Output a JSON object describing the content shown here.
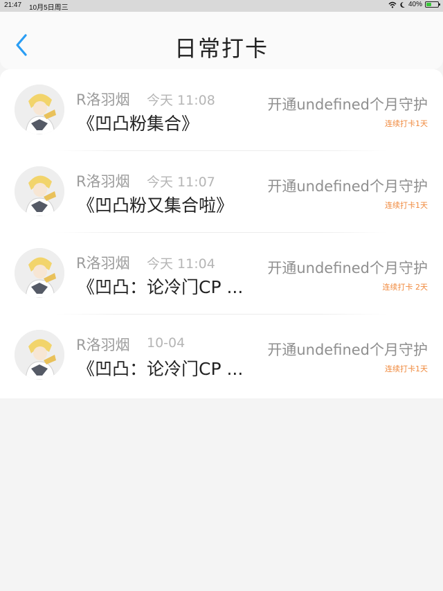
{
  "status_bar": {
    "time": "21:47",
    "date": "10月5日周三",
    "battery": "40%",
    "battery_level": 0.4,
    "wifi_icon": "wifi-icon",
    "moon_icon": "moon-icon"
  },
  "header": {
    "title": "日常打卡",
    "back_icon": "chevron-left-icon",
    "accent_color": "#2a9df4"
  },
  "colors": {
    "streak": "#f08a3e",
    "background": "#f4f4f4"
  },
  "items": [
    {
      "username": "R洛羽烟",
      "time": "今天 11:08",
      "title": "《凹凸粉集合》",
      "guard": "开通undefined个月守护",
      "streak": "连续打卡1天"
    },
    {
      "username": "R洛羽烟",
      "time": "今天 11:07",
      "title": "《凹凸粉又集合啦》",
      "guard": "开通undefined个月守护",
      "streak": "连续打卡1天"
    },
    {
      "username": "R洛羽烟",
      "time": "今天 11:04",
      "title": "《凹凸：论冷门CP ...",
      "guard": "开通undefined个月守护",
      "streak": "连续打卡 2天"
    },
    {
      "username": "R洛羽烟",
      "time": "10-04",
      "title": "《凹凸：论冷门CP ...",
      "guard": "开通undefined个月守护",
      "streak": "连续打卡1天"
    }
  ]
}
